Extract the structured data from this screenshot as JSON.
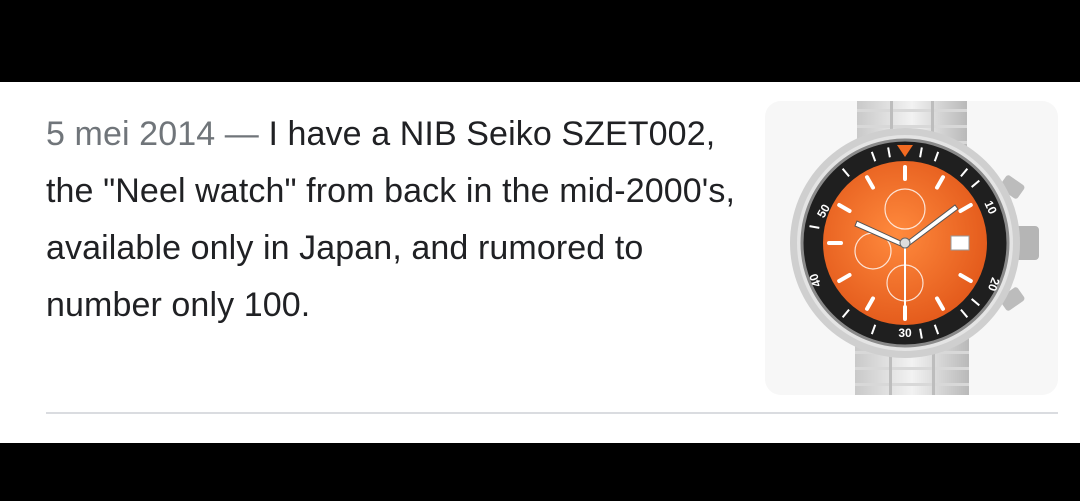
{
  "result": {
    "date": "5 mei 2014",
    "separator": " — ",
    "snippet": "I have a NIB Seiko SZET002, the \"Neel watch\" from back in the mid-2000's, available only in Japan, and rumored to number only 100.",
    "thumbnail": {
      "icon": "wristwatch-image",
      "dial_color": "#f26a21",
      "bezel_color": "#222222",
      "bezel_numbers": [
        "50",
        "40",
        "30",
        "20",
        "10"
      ]
    }
  }
}
